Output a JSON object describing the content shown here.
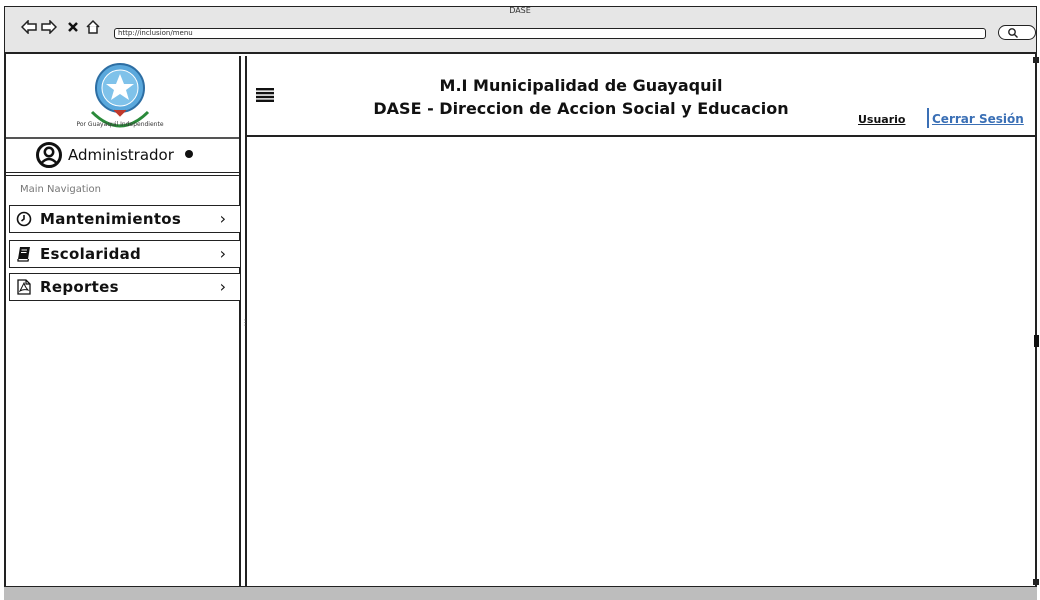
{
  "window": {
    "title": "DASE",
    "url": "http://inclusion/menu"
  },
  "header": {
    "title_line1": "M.I Municipalidad de Guayaquil",
    "title_line2": "DASE - Direccion de Accion Social y Educacion",
    "user_link": "Usuario",
    "logout_link": "Cerrar Sesión"
  },
  "sidebar": {
    "user": {
      "name": "Administrador"
    },
    "section_header": "Main Navigation",
    "items": [
      {
        "label": "Mantenimientos",
        "icon": "clock-icon"
      },
      {
        "label": "Escolaridad",
        "icon": "book-icon"
      },
      {
        "label": "Reportes",
        "icon": "pdf-icon"
      }
    ]
  },
  "logo": {
    "caption": "Por Guayaquil Independiente"
  },
  "colors": {
    "link": "#3a6fb5",
    "logo_blue": "#5aa8dc"
  }
}
